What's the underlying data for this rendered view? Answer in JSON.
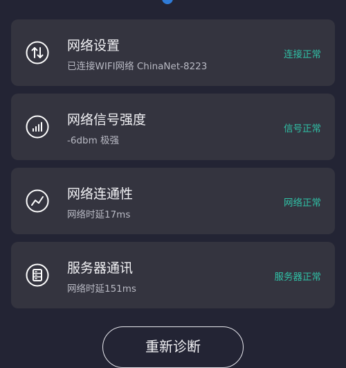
{
  "cards": [
    {
      "title": "网络设置",
      "subtitle": "已连接WIFI网络 ChinaNet-8223",
      "status": "连接正常",
      "icon": "updown-arrows-icon"
    },
    {
      "title": "网络信号强度",
      "subtitle": "-6dbm 极强",
      "status": "信号正常",
      "icon": "signal-strength-icon"
    },
    {
      "title": "网络连通性",
      "subtitle": "网络时延17ms",
      "status": "网络正常",
      "icon": "trend-line-icon"
    },
    {
      "title": "服务器通讯",
      "subtitle": "网络时延151ms",
      "status": "服务器正常",
      "icon": "server-icon"
    }
  ],
  "actions": {
    "rediagnose_label": "重新诊断"
  },
  "colors": {
    "background": "#232434",
    "card": "#34343f",
    "status_ok": "#30c2a7",
    "top_accent": "#2f7bd6"
  }
}
